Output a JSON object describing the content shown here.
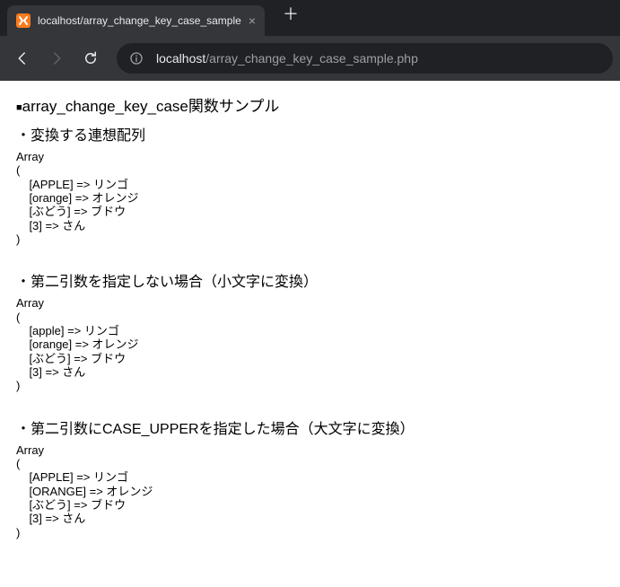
{
  "browser": {
    "tab_title": "localhost/array_change_key_case_sample",
    "url_host": "localhost",
    "url_path": "/array_change_key_case_sample.php",
    "new_tab_glyph": "＋",
    "close_glyph": "×"
  },
  "page": {
    "title_prefix": "■",
    "title": "array_change_key_case関数サンプル",
    "sections": [
      {
        "label": "・変換する連想配列",
        "items": [
          {
            "k": "APPLE",
            "v": "リンゴ"
          },
          {
            "k": "orange",
            "v": "オレンジ"
          },
          {
            "k": "ぶどう",
            "v": "ブドウ"
          },
          {
            "k": "3",
            "v": "さん"
          }
        ]
      },
      {
        "label": "・第二引数を指定しない場合（小文字に変換）",
        "items": [
          {
            "k": "apple",
            "v": "リンゴ"
          },
          {
            "k": "orange",
            "v": "オレンジ"
          },
          {
            "k": "ぶどう",
            "v": "ブドウ"
          },
          {
            "k": "3",
            "v": "さん"
          }
        ]
      },
      {
        "label": "・第二引数にCASE_UPPERを指定した場合（大文字に変換）",
        "items": [
          {
            "k": "APPLE",
            "v": "リンゴ"
          },
          {
            "k": "ORANGE",
            "v": "オレンジ"
          },
          {
            "k": "ぶどう",
            "v": "ブドウ"
          },
          {
            "k": "3",
            "v": "さん"
          }
        ]
      }
    ]
  }
}
